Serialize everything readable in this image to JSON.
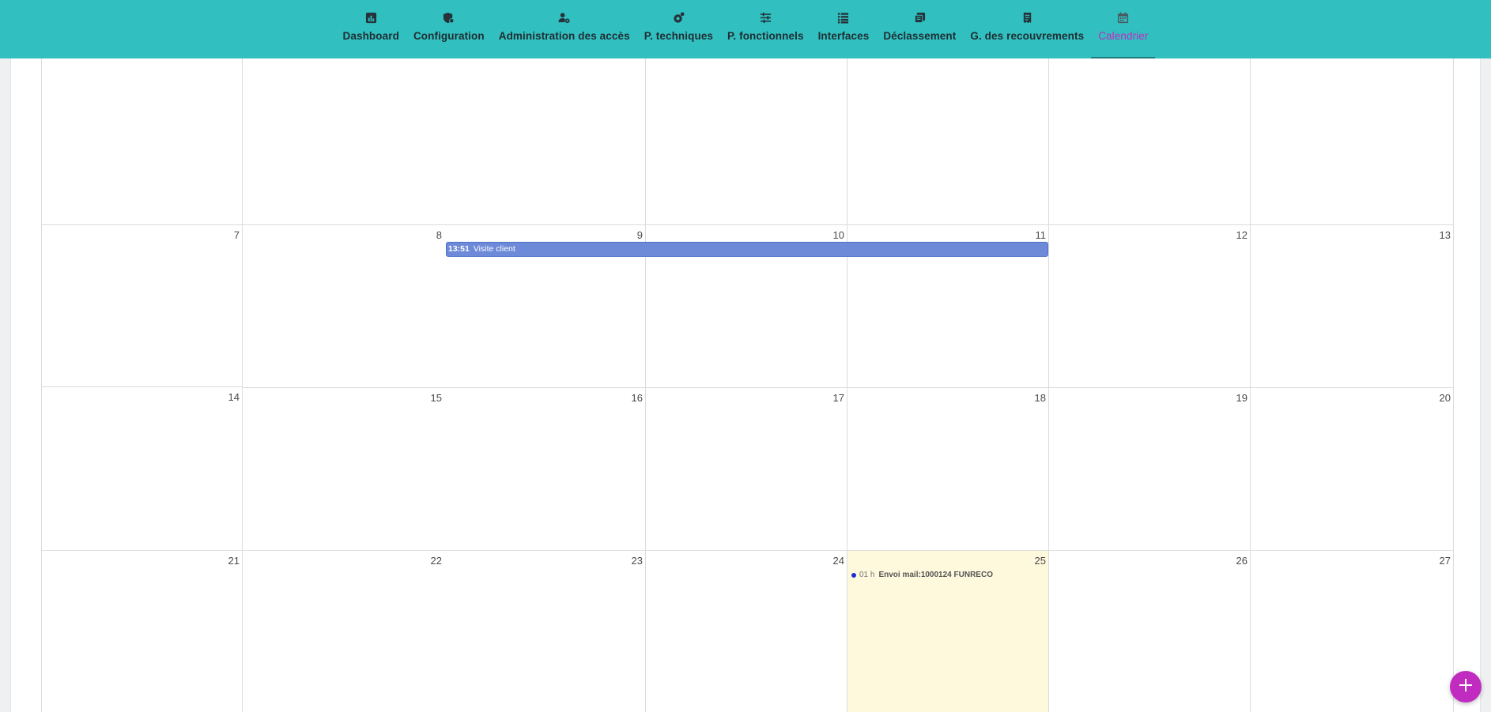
{
  "nav": {
    "items": [
      {
        "label": "Dashboard",
        "icon": "chart-bar-icon"
      },
      {
        "label": "Configuration",
        "icon": "shield-gear-icon"
      },
      {
        "label": "Administration des accès",
        "icon": "user-cog-icon"
      },
      {
        "label": "P. techniques",
        "icon": "gear-icon"
      },
      {
        "label": "P. fonctionnels",
        "icon": "sliders-icon"
      },
      {
        "label": "Interfaces",
        "icon": "list-icon"
      },
      {
        "label": "Déclassement",
        "icon": "layers-icon"
      },
      {
        "label": "G. des recouvrements",
        "icon": "receipt-icon"
      },
      {
        "label": "Calendrier",
        "icon": "calendar-icon",
        "active": true
      }
    ]
  },
  "calendar": {
    "weeks": [
      {
        "days": [
          "",
          "",
          "",
          "",
          "",
          "",
          ""
        ]
      },
      {
        "days": [
          "7",
          "8",
          "9",
          "10",
          "11",
          "12",
          "13"
        ]
      },
      {
        "days": [
          "14",
          "15",
          "16",
          "17",
          "18",
          "19",
          "20"
        ]
      },
      {
        "days": [
          "21",
          "22",
          "23",
          "24",
          "25",
          "26",
          "27"
        ]
      }
    ],
    "today": "25",
    "events": {
      "visite": {
        "time": "13:51",
        "title": "Visite client"
      },
      "envoi": {
        "time": "01 h",
        "title": "Envoi mail:1000124 FUNRECO"
      }
    }
  },
  "colors": {
    "nav_bg": "#31bfbf",
    "accent": "#c02cc0",
    "event_bar": "#6d8ad8",
    "today_bg": "#fef8dd",
    "event_dot": "#1b2fd4"
  },
  "fab": {
    "icon": "plus-icon"
  }
}
